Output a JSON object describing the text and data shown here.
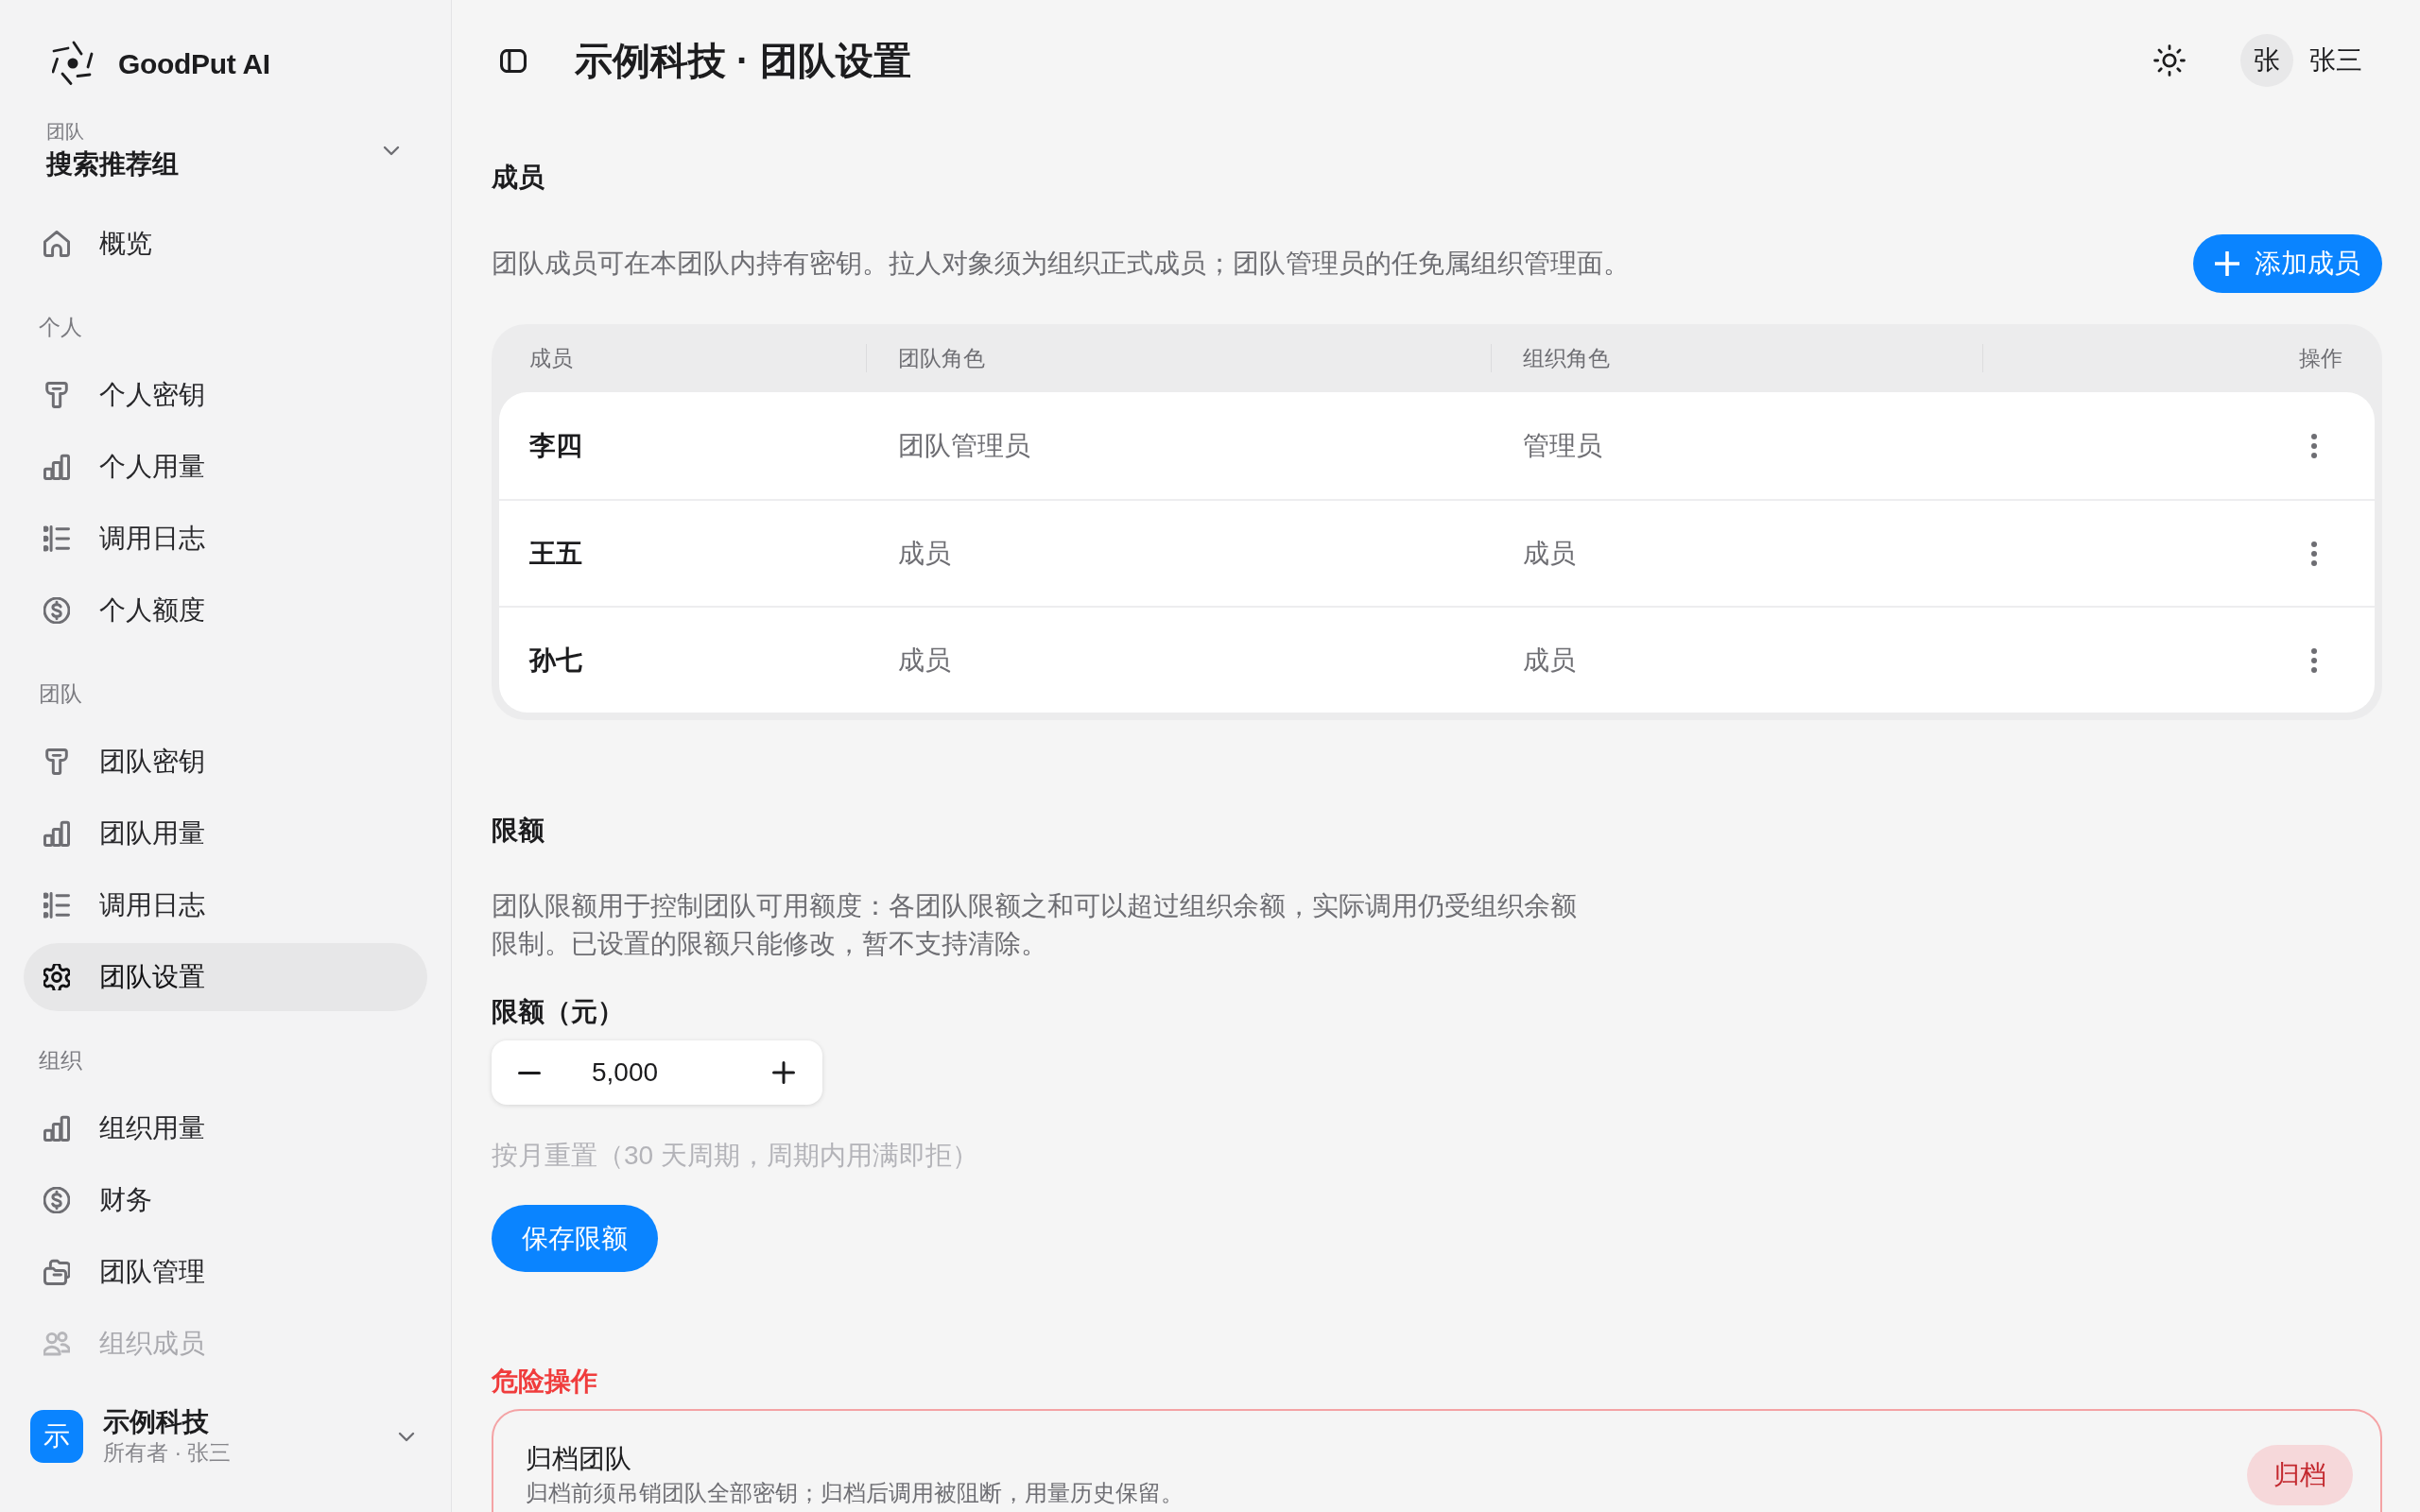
{
  "sidebar": {
    "brand": "GoodPut AI",
    "team_switcher": {
      "label": "团队",
      "value": "搜索推荐组"
    },
    "sections": [
      {
        "items": [
          {
            "label": "概览",
            "kind": "home",
            "selected": false,
            "disabled": false
          }
        ]
      },
      {
        "title": "个人",
        "items": [
          {
            "label": "个人密钥",
            "kind": "key",
            "selected": false,
            "disabled": false
          },
          {
            "label": "个人用量",
            "kind": "chart",
            "selected": false,
            "disabled": false
          },
          {
            "label": "调用日志",
            "kind": "list",
            "selected": false,
            "disabled": false
          },
          {
            "label": "个人额度",
            "kind": "dollar",
            "selected": false,
            "disabled": false
          }
        ]
      },
      {
        "title": "团队",
        "items": [
          {
            "label": "团队密钥",
            "kind": "key",
            "selected": false,
            "disabled": false
          },
          {
            "label": "团队用量",
            "kind": "chart",
            "selected": false,
            "disabled": false
          },
          {
            "label": "调用日志",
            "kind": "list",
            "selected": false,
            "disabled": false
          },
          {
            "label": "团队设置",
            "kind": "gear",
            "selected": true,
            "disabled": false
          }
        ]
      },
      {
        "title": "组织",
        "items": [
          {
            "label": "组织用量",
            "kind": "chart",
            "selected": false,
            "disabled": false
          },
          {
            "label": "财务",
            "kind": "dollar",
            "selected": false,
            "disabled": false
          },
          {
            "label": "团队管理",
            "kind": "folders",
            "selected": false,
            "disabled": false
          },
          {
            "label": "组织成员",
            "kind": "users",
            "selected": false,
            "disabled": true
          }
        ]
      }
    ],
    "org_switcher": {
      "badge": "示",
      "name": "示例科技",
      "subtitle": "所有者 · 张三"
    }
  },
  "header": {
    "title": "示例科技 · 团队设置",
    "avatar": "张",
    "user_name": "张三"
  },
  "members": {
    "title": "成员",
    "description": "团队成员可在本团队内持有密钥。拉人对象须为组织正式成员；团队管理员的任免属组织管理面。",
    "add_button": "添加成员",
    "table": {
      "columns": [
        "成员",
        "团队角色",
        "组织角色",
        "操作"
      ],
      "rows": [
        {
          "member": "李四",
          "team_role": "团队管理员",
          "org_role": "管理员"
        },
        {
          "member": "王五",
          "team_role": "成员",
          "org_role": "成员"
        },
        {
          "member": "孙七",
          "team_role": "成员",
          "org_role": "成员"
        }
      ]
    }
  },
  "limit": {
    "title": "限额",
    "description": "团队限额用于控制团队可用额度：各团队限额之和可以超过组织余额，实际调用仍受组织余额限制。已设置的限额只能修改，暂不支持清除。",
    "field_label": "限额（元）",
    "value": "5,000",
    "hint": "按月重置（30 天周期，周期内用满即拒）",
    "save_button": "保存限额"
  },
  "danger": {
    "title": "危险操作",
    "items": [
      {
        "title": "归档团队",
        "description": "归档前须吊销团队全部密钥；归档后调用被阻断，用量历史保留。",
        "button": "归档"
      }
    ]
  }
}
